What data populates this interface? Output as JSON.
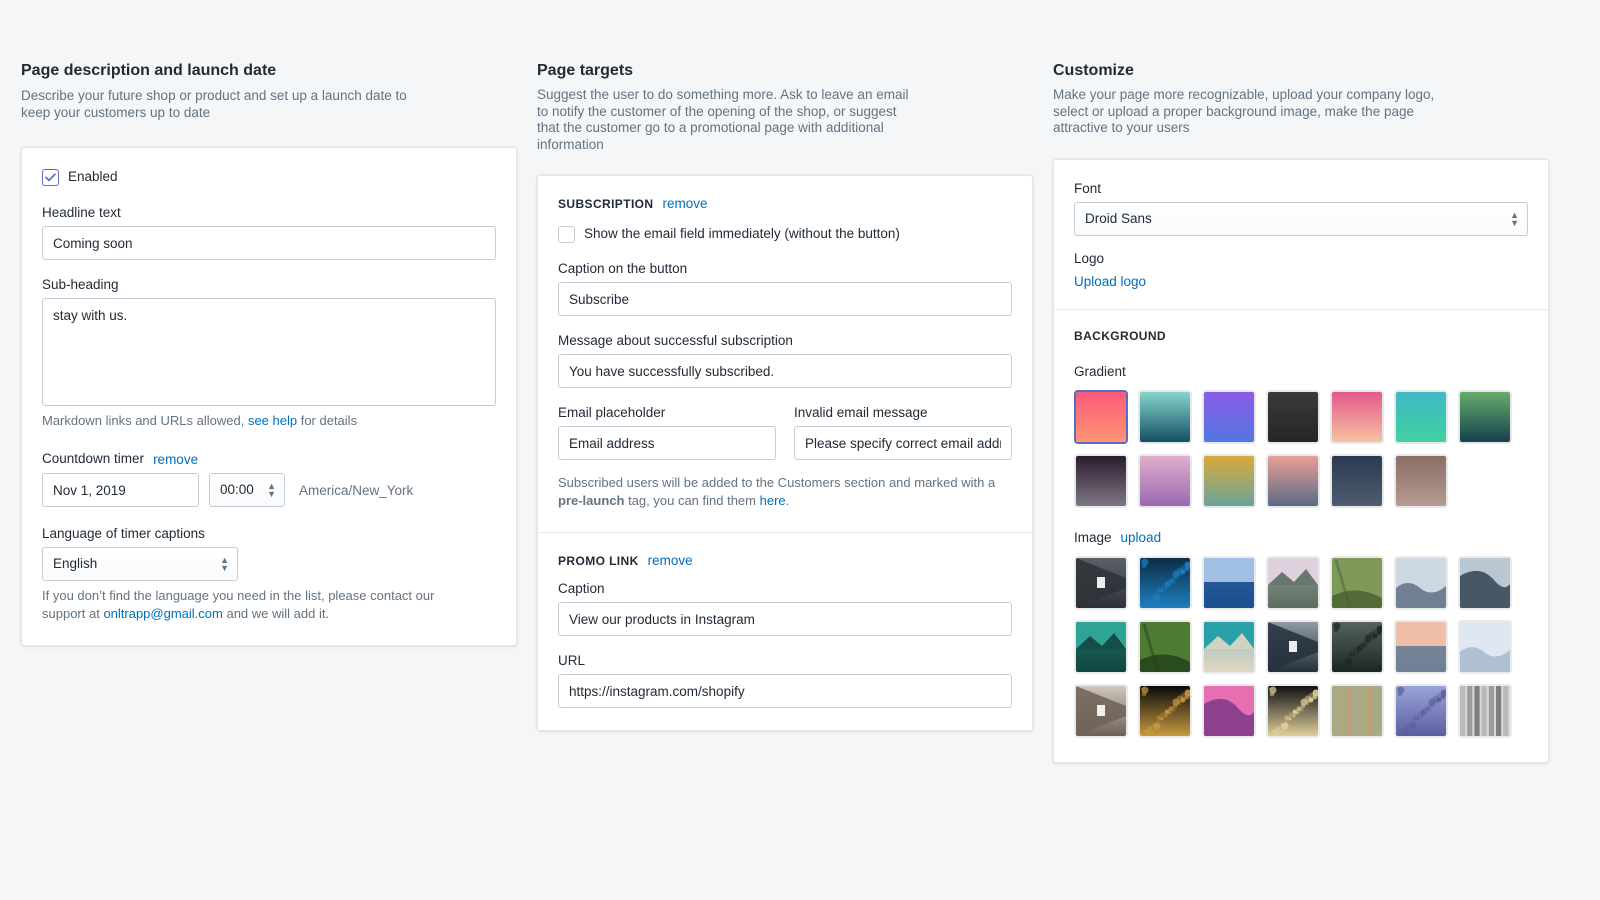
{
  "columns": {
    "left": {
      "title": "Page description and launch date",
      "description": "Describe your future shop or product and set up a launch date to keep your customers up to date",
      "enabled_checkbox": {
        "label": "Enabled",
        "checked": true
      },
      "headline": {
        "label": "Headline text",
        "value": "Coming soon"
      },
      "subheading": {
        "label": "Sub-heading",
        "value": "stay with us."
      },
      "markdown_help": {
        "before": "Markdown links and URLs allowed, ",
        "link": "see help",
        "after": " for details"
      },
      "countdown": {
        "label": "Countdown timer",
        "remove_label": "remove",
        "date_value": "Nov 1, 2019",
        "time_value": "00:00",
        "timezone": "America/New_York"
      },
      "language": {
        "label": "Language of timer captions",
        "value": "English",
        "options": [
          "English"
        ]
      },
      "language_help": {
        "before": "If you don’t find the language you need in the list, please contact our support at ",
        "link": "onltrapp@gmail.com",
        "after": " and we will add it."
      }
    },
    "middle": {
      "title": "Page targets",
      "description": "Suggest the user to do something more. Ask to leave an email to notify the customer of the opening of the shop, or suggest that the customer go to a promotional page with additional information",
      "subscription": {
        "heading": "SUBSCRIPTION",
        "remove_label": "remove",
        "show_email_checkbox": {
          "label": "Show the email field immediately (without the button)",
          "checked": false
        },
        "button_caption": {
          "label": "Caption on the button",
          "value": "Subscribe"
        },
        "success_message": {
          "label": "Message about successful subscription",
          "value": "You have successfully subscribed."
        },
        "email_placeholder": {
          "label": "Email placeholder",
          "value": "Email address"
        },
        "invalid_email": {
          "label": "Invalid email message",
          "value": "Please specify correct email address"
        },
        "note": {
          "part1": "Subscribed users will be added to the Customers section and marked with a ",
          "bold": "pre-launch",
          "part2": " tag, you can find them ",
          "link": "here",
          "part3": "."
        }
      },
      "promo_link": {
        "heading": "PROMO LINK",
        "remove_label": "remove",
        "caption": {
          "label": "Caption",
          "value": "View our products in Instagram"
        },
        "url": {
          "label": "URL",
          "value": "https://instagram.com/shopify"
        }
      }
    },
    "right": {
      "title": "Customize",
      "description": "Make your page more recognizable, upload your company logo, select or upload a proper background image, make the page attractive to your users",
      "font": {
        "label": "Font",
        "value": "Droid Sans",
        "options": [
          "Droid Sans"
        ]
      },
      "logo": {
        "label": "Logo",
        "upload_label": "Upload logo"
      },
      "background": {
        "heading": "BACKGROUND",
        "gradient_label": "Gradient",
        "image_label": "Image",
        "image_upload_label": "upload",
        "gradients": [
          {
            "name": "coral-pink",
            "from": "#f95b7a",
            "to": "#ff9574",
            "selected": true
          },
          {
            "name": "teal-deep-blue",
            "from": "#86d5cb",
            "to": "#134e63",
            "selected": false
          },
          {
            "name": "violet-blue",
            "from": "#8b5ce8",
            "to": "#5277e0",
            "selected": false
          },
          {
            "name": "charcoal",
            "from": "#3a3a3c",
            "to": "#262628",
            "selected": false
          },
          {
            "name": "pink-peach",
            "from": "#e3588d",
            "to": "#f7c3a0",
            "selected": false
          },
          {
            "name": "turquoise-green",
            "from": "#3fb8c6",
            "to": "#3fd1a0",
            "selected": false
          },
          {
            "name": "green-teal-dark",
            "from": "#66ac6a",
            "to": "#16404f",
            "selected": false
          },
          {
            "name": "dark-plum",
            "from": "#2b1b2e",
            "to": "#7e7784",
            "selected": false
          },
          {
            "name": "pink-lilac",
            "from": "#e0aecb",
            "to": "#9b69b2",
            "selected": false
          },
          {
            "name": "gold-teal",
            "from": "#d9a93c",
            "to": "#6aa49a",
            "selected": false
          },
          {
            "name": "salmon-slate",
            "from": "#e8a095",
            "to": "#5b6a86",
            "selected": false
          },
          {
            "name": "navy-slate",
            "from": "#2c3a52",
            "to": "#4e5c70",
            "selected": false
          },
          {
            "name": "mauve-taupe",
            "from": "#8b6d64",
            "to": "#b59b92",
            "selected": false
          }
        ],
        "images": [
          {
            "name": "corridor-light"
          },
          {
            "name": "blue-crystals"
          },
          {
            "name": "blurred-blue-bokeh"
          },
          {
            "name": "lake-mountain-sunrise"
          },
          {
            "name": "aerial-green-fields"
          },
          {
            "name": "foggy-forest"
          },
          {
            "name": "snow-wave"
          },
          {
            "name": "turquoise-lake"
          },
          {
            "name": "green-bamboo"
          },
          {
            "name": "coastal-cliff"
          },
          {
            "name": "underpass-tunnel"
          },
          {
            "name": "city-aerial"
          },
          {
            "name": "sunset-shore-towers"
          },
          {
            "name": "winter-city-fog"
          },
          {
            "name": "paris-street"
          },
          {
            "name": "city-lights-night"
          },
          {
            "name": "pink-crystal"
          },
          {
            "name": "night-bokeh"
          },
          {
            "name": "painted-wood-planks"
          },
          {
            "name": "water-droplets"
          },
          {
            "name": "grey-textured-waves"
          }
        ]
      }
    }
  }
}
